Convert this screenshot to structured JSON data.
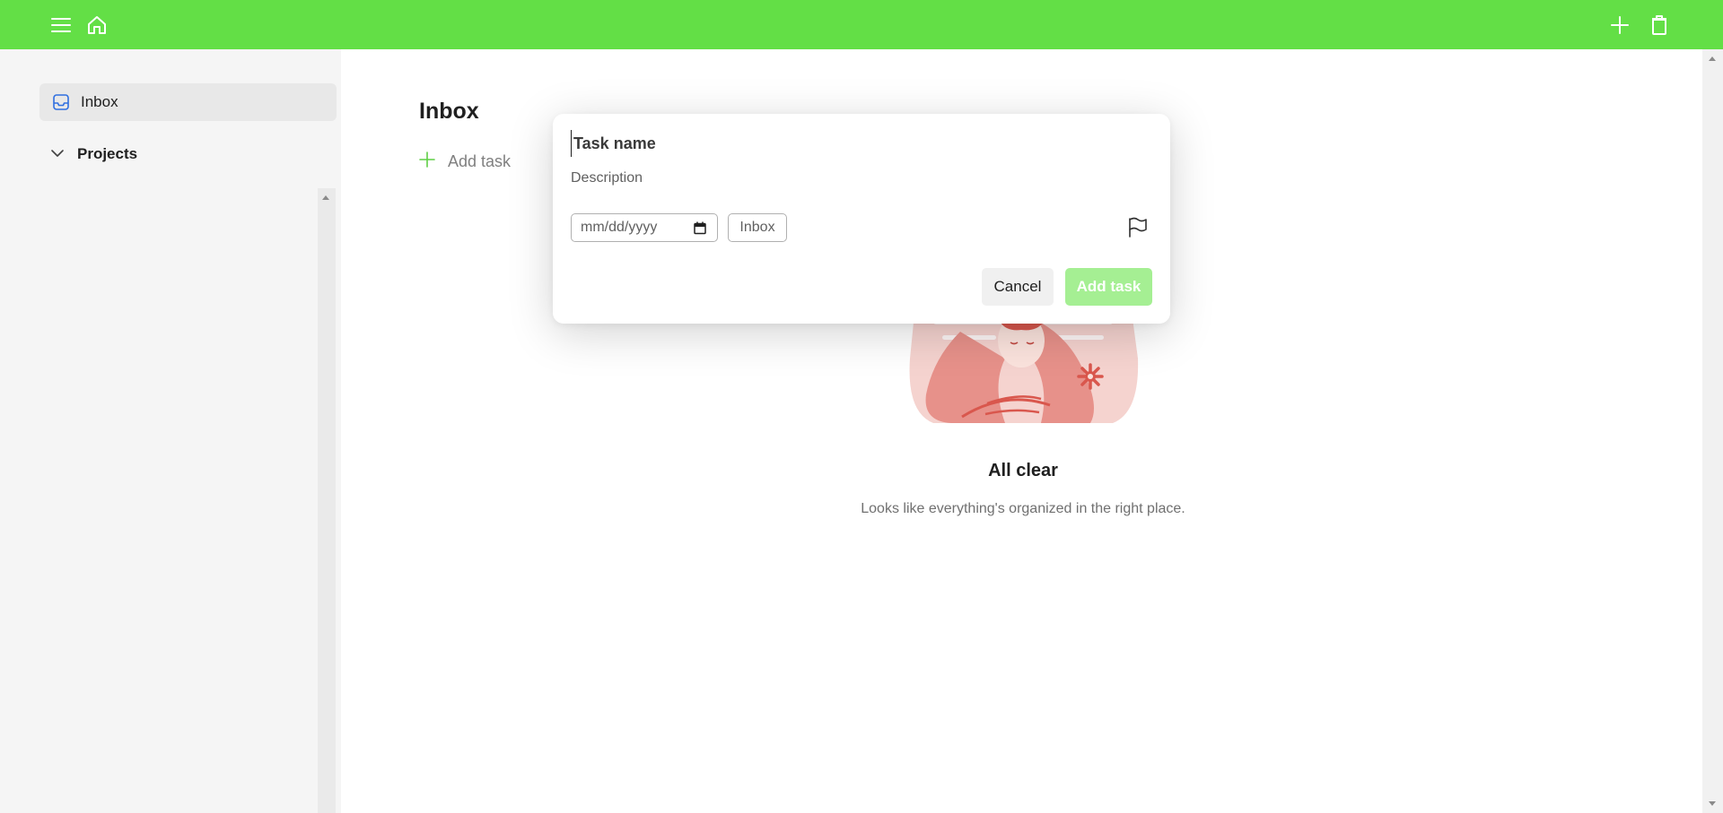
{
  "topbar": {
    "color": "#63df46",
    "icons": [
      "menu-icon",
      "home-icon",
      "plus-icon",
      "trash-icon"
    ]
  },
  "sidebar": {
    "inbox_label": "Inbox",
    "projects_label": "Projects"
  },
  "main": {
    "title": "Inbox",
    "add_task_label": "Add task",
    "empty_title": "All clear",
    "empty_subtitle": "Looks like everything's organized in the right place."
  },
  "modal": {
    "task_name_placeholder": "Task name",
    "description_placeholder": "Description",
    "date_placeholder": "mm/dd/yyyy",
    "project_label": "Inbox",
    "cancel_label": "Cancel",
    "add_label": "Add task",
    "add_button_color": "#a5ef93"
  }
}
